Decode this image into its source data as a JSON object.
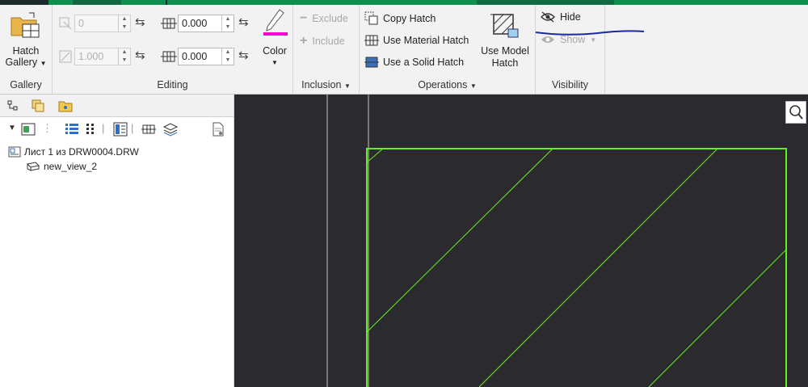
{
  "ribbon": {
    "gallery": {
      "button_line1": "Hatch",
      "button_line2": "Gallery",
      "group_label": "Gallery"
    },
    "editing": {
      "group_label": "Editing",
      "angle_value": "0",
      "scale_value": "1.000",
      "spacing_value": "0.000",
      "offset_value": "0.000",
      "color_label": "Color"
    },
    "inclusion": {
      "exclude_label": "Exclude",
      "include_label": "Include",
      "group_label": "Inclusion"
    },
    "operations": {
      "copy_hatch": "Copy Hatch",
      "use_material_hatch": "Use Material Hatch",
      "use_solid_hatch": "Use a Solid Hatch",
      "use_model_line1": "Use Model",
      "use_model_line2": "Hatch",
      "group_label": "Operations"
    },
    "visibility": {
      "hide_label": "Hide",
      "show_label": "Show",
      "group_label": "Visibility"
    }
  },
  "tree": {
    "root_label": "Лист 1 из DRW0004.DRW",
    "child_label": "new_view_2"
  },
  "colors": {
    "accent_magenta": "#ff00cc",
    "hatch_green": "#66ee22",
    "annotation_blue": "#1a2aa0"
  }
}
